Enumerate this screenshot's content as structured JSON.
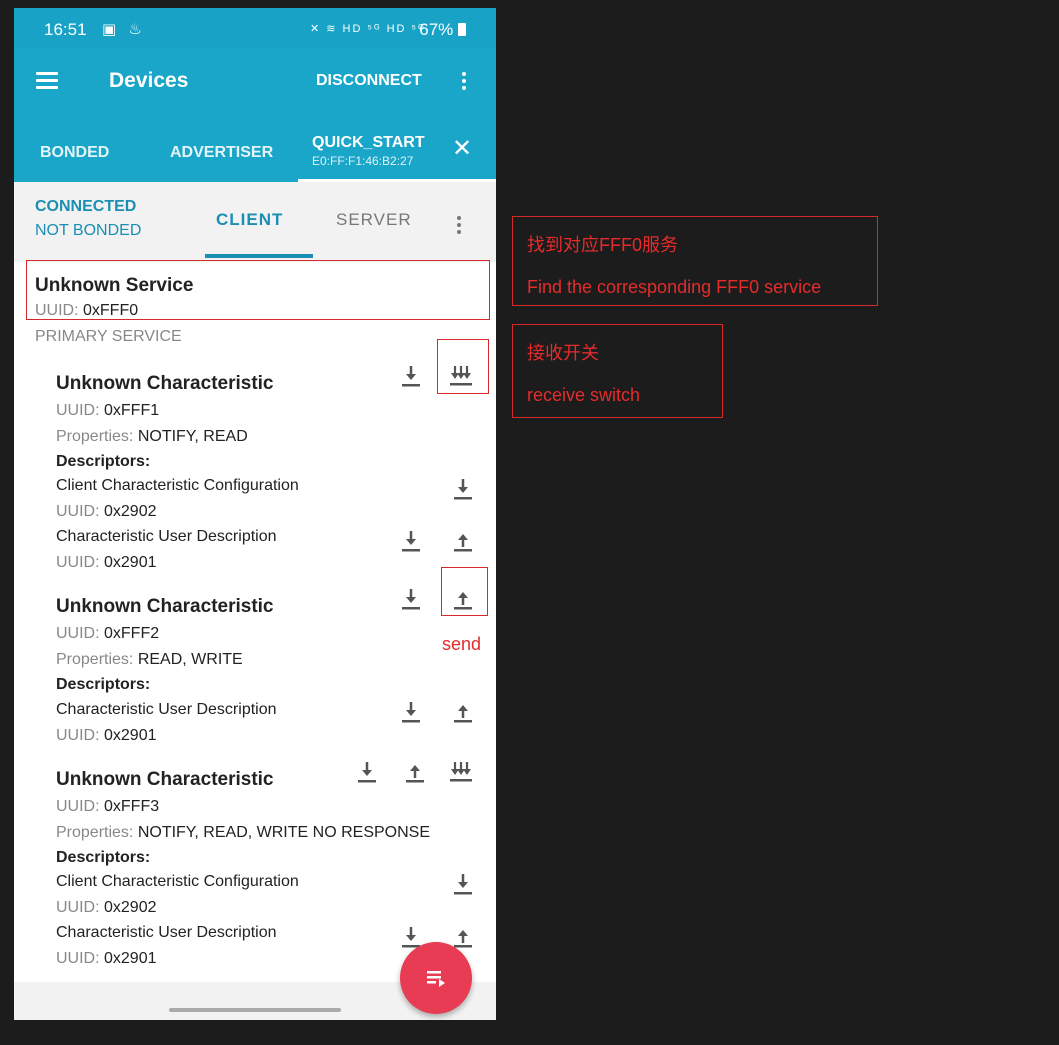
{
  "status_bar": {
    "time": "16:51",
    "left_icons": "▣ ♨",
    "signal_icons": "✕ ≋ HD ⁵ᴳ HD ⁵ᴳ",
    "battery": "67%"
  },
  "app_bar": {
    "title": "Devices",
    "disconnect_label": "DISCONNECT"
  },
  "tabs": {
    "bonded": "BONDED",
    "advertiser": "ADVERTISER",
    "quick_start": "QUICK_START",
    "mac": "E0:FF:F1:46:B2:27",
    "close": "✕"
  },
  "sub_bar": {
    "connected": "CONNECTED",
    "not_bonded": "NOT BONDED",
    "client": "CLIENT",
    "server": "SERVER"
  },
  "service": {
    "name": "Unknown Service",
    "uuid_label": "UUID: ",
    "uuid": "0xFFF0",
    "type": "PRIMARY SERVICE"
  },
  "labels": {
    "uuid": "UUID: ",
    "properties": "Properties: ",
    "descriptors": "Descriptors:"
  },
  "characteristics": [
    {
      "name": "Unknown Characteristic",
      "uuid": "0xFFF1",
      "properties": "NOTIFY, READ",
      "descriptors": [
        {
          "name": "Client Characteristic Configuration",
          "uuid": "0x2902"
        },
        {
          "name": "Characteristic User Description",
          "uuid": "0x2901"
        }
      ]
    },
    {
      "name": "Unknown Characteristic",
      "uuid": "0xFFF2",
      "properties": "READ, WRITE",
      "descriptors": [
        {
          "name": "Characteristic User Description",
          "uuid": "0x2901"
        }
      ]
    },
    {
      "name": "Unknown Characteristic",
      "uuid": "0xFFF3",
      "properties": "NOTIFY, READ, WRITE NO RESPONSE",
      "descriptors": [
        {
          "name": "Client Characteristic Configuration",
          "uuid": "0x2902"
        },
        {
          "name": "Characteristic User Description",
          "uuid": "0x2901"
        }
      ]
    }
  ],
  "annotations": {
    "service_zh": "找到对应FFF0服务",
    "service_en": "Find the corresponding FFF0 service",
    "receive_zh": "接收开关",
    "receive_en": "receive switch",
    "send": "send"
  },
  "colors": {
    "app_bar": "#1aa6c9",
    "accent": "#1a8fb3",
    "fab": "#e83b54",
    "annotation": "#e62b2b",
    "background": "#1c1c1c"
  }
}
